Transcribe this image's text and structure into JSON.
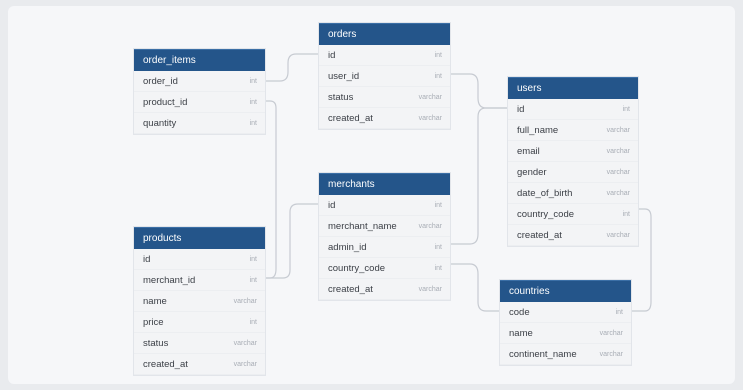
{
  "tables": {
    "orders": {
      "name": "orders",
      "columns": [
        {
          "name": "id",
          "type": "int"
        },
        {
          "name": "user_id",
          "type": "int"
        },
        {
          "name": "status",
          "type": "varchar"
        },
        {
          "name": "created_at",
          "type": "varchar"
        }
      ]
    },
    "order_items": {
      "name": "order_items",
      "columns": [
        {
          "name": "order_id",
          "type": "int"
        },
        {
          "name": "product_id",
          "type": "int"
        },
        {
          "name": "quantity",
          "type": "int"
        }
      ]
    },
    "users": {
      "name": "users",
      "columns": [
        {
          "name": "id",
          "type": "int"
        },
        {
          "name": "full_name",
          "type": "varchar"
        },
        {
          "name": "email",
          "type": "varchar"
        },
        {
          "name": "gender",
          "type": "varchar"
        },
        {
          "name": "date_of_birth",
          "type": "varchar"
        },
        {
          "name": "country_code",
          "type": "int"
        },
        {
          "name": "created_at",
          "type": "varchar"
        }
      ]
    },
    "merchants": {
      "name": "merchants",
      "columns": [
        {
          "name": "id",
          "type": "int"
        },
        {
          "name": "merchant_name",
          "type": "varchar"
        },
        {
          "name": "admin_id",
          "type": "int"
        },
        {
          "name": "country_code",
          "type": "int"
        },
        {
          "name": "created_at",
          "type": "varchar"
        }
      ]
    },
    "products": {
      "name": "products",
      "columns": [
        {
          "name": "id",
          "type": "int"
        },
        {
          "name": "merchant_id",
          "type": "int"
        },
        {
          "name": "name",
          "type": "varchar"
        },
        {
          "name": "price",
          "type": "int"
        },
        {
          "name": "status",
          "type": "varchar"
        },
        {
          "name": "created_at",
          "type": "varchar"
        }
      ]
    },
    "countries": {
      "name": "countries",
      "columns": [
        {
          "name": "code",
          "type": "int"
        },
        {
          "name": "name",
          "type": "varchar"
        },
        {
          "name": "continent_name",
          "type": "varchar"
        }
      ]
    }
  },
  "colors": {
    "header": "#24558a",
    "link": "#c7cbd2"
  }
}
